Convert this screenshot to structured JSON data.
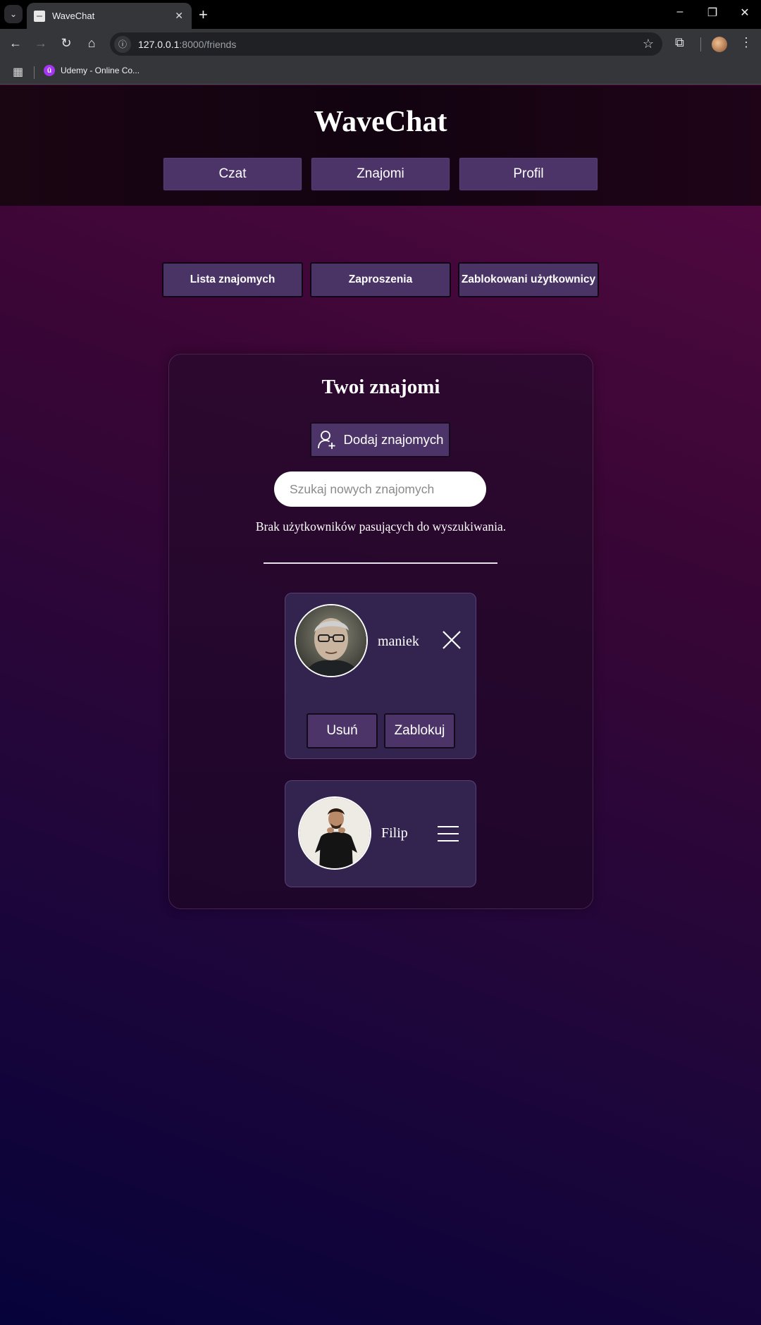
{
  "browser": {
    "tab_title": "WaveChat",
    "url_host": "127.0.0.1",
    "url_path": ":8000/friends",
    "bookmark_label": "Udemy - Online Co..."
  },
  "app": {
    "brand": "WaveChat",
    "main_nav": [
      "Czat",
      "Znajomi",
      "Profil"
    ],
    "sub_nav": [
      "Lista znajomych",
      "Zaproszenia",
      "Zablokowani użytkownicy"
    ]
  },
  "friends": {
    "title": "Twoi znajomi",
    "add_button": "Dodaj znajomych",
    "search_placeholder": "Szukaj nowych znajomych",
    "no_results": "Brak użytkowników pasujących do wyszukiwania.",
    "list": [
      {
        "name": "maniek",
        "actions": [
          "Usuń",
          "Zablokuj"
        ],
        "expanded": true
      },
      {
        "name": "Filip",
        "expanded": false
      }
    ]
  },
  "colors": {
    "button_bg": "#4d3468",
    "card_item_bg": "#33244f",
    "header_bg": "#120310"
  }
}
